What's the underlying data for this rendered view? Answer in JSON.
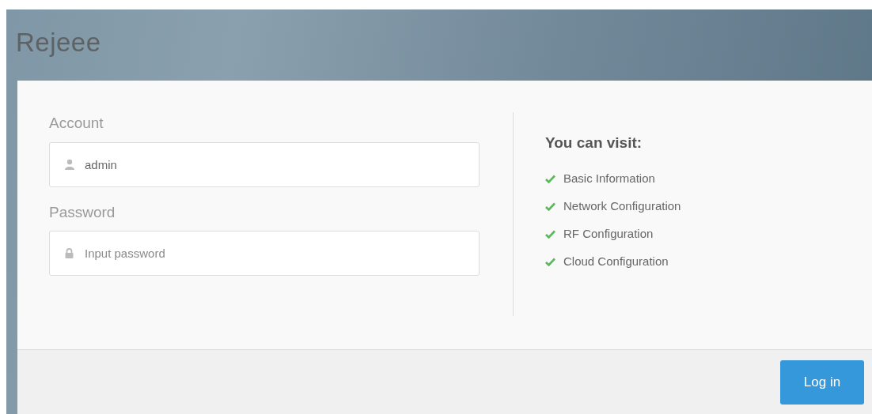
{
  "header": {
    "title": "Rejeee"
  },
  "form": {
    "fields": [
      {
        "label": "Account",
        "kind": "user",
        "value": "admin"
      },
      {
        "label": "Password",
        "kind": "lock",
        "placeholder": "Input password"
      }
    ]
  },
  "visit": {
    "title": "You can visit:",
    "items": [
      {
        "label": "Basic Information",
        "checked": true
      },
      {
        "label": "Network Configuration",
        "checked": true
      },
      {
        "label": "RF Configuration",
        "checked": true
      },
      {
        "label": "Cloud Configuration",
        "checked": true
      }
    ]
  },
  "footer": {
    "button": "Log in"
  }
}
